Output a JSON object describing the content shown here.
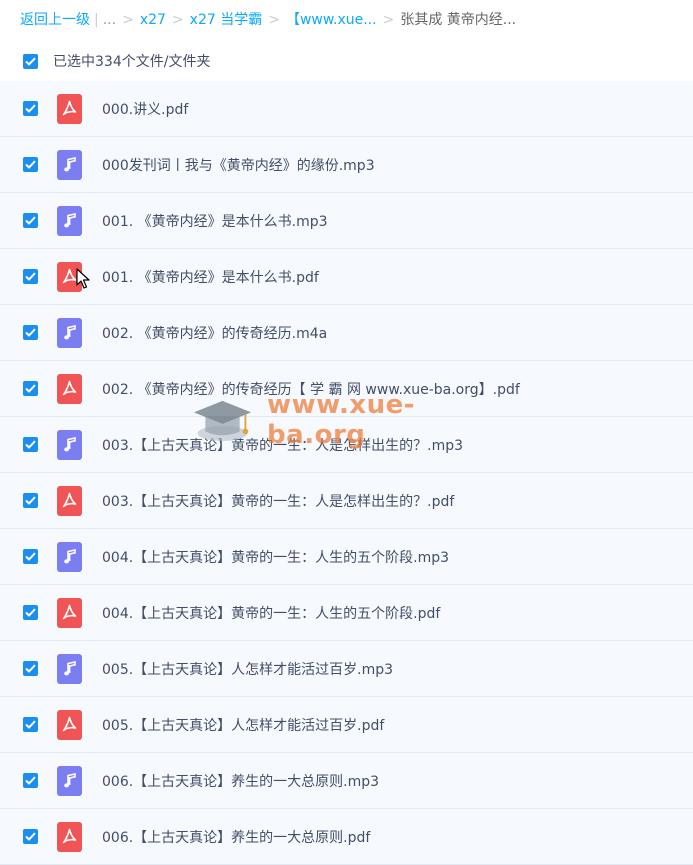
{
  "breadcrumb": {
    "back": "返回上一级",
    "pipe": "|",
    "ellipsis": "...",
    "items": [
      "x27",
      "x27 当学霸",
      "【www.xue...",
      "张其成 黄帝内经..."
    ]
  },
  "selection": {
    "label": "已选中334个文件/文件夹",
    "checked": true
  },
  "files": [
    {
      "name": "000.讲义.pdf",
      "type": "pdf",
      "checked": true
    },
    {
      "name": "000发刊词丨我与《黄帝内经》的缘份.mp3",
      "type": "audio",
      "checked": true
    },
    {
      "name": "001. 《黄帝内经》是本什么书.mp3",
      "type": "audio",
      "checked": true
    },
    {
      "name": "001. 《黄帝内经》是本什么书.pdf",
      "type": "pdf",
      "checked": true
    },
    {
      "name": "002. 《黄帝内经》的传奇经历.m4a",
      "type": "audio",
      "checked": true
    },
    {
      "name": "002. 《黄帝内经》的传奇经历【 学 霸 网 www.xue-ba.org】.pdf",
      "type": "pdf",
      "checked": true
    },
    {
      "name": "003.【上古天真论】黄帝的一生：人是怎样出生的？.mp3",
      "type": "audio",
      "checked": true
    },
    {
      "name": "003.【上古天真论】黄帝的一生：人是怎样出生的？.pdf",
      "type": "pdf",
      "checked": true
    },
    {
      "name": "004.【上古天真论】黄帝的一生：人生的五个阶段.mp3",
      "type": "audio",
      "checked": true
    },
    {
      "name": "004.【上古天真论】黄帝的一生：人生的五个阶段.pdf",
      "type": "pdf",
      "checked": true
    },
    {
      "name": "005.【上古天真论】人怎样才能活过百岁.mp3",
      "type": "audio",
      "checked": true
    },
    {
      "name": "005.【上古天真论】人怎样才能活过百岁.pdf",
      "type": "pdf",
      "checked": true
    },
    {
      "name": "006.【上古天真论】养生的一大总原则.mp3",
      "type": "audio",
      "checked": true
    },
    {
      "name": "006.【上古天真论】养生的一大总原则.pdf",
      "type": "pdf",
      "checked": true
    }
  ],
  "watermark": {
    "text": "www.xue-ba.org",
    "icon": "graduation-cap-icon"
  },
  "icons": {
    "pdf": "pdf-file-icon",
    "audio": "music-file-icon",
    "check": "checkmark-icon"
  },
  "colors": {
    "link": "#09aaff",
    "checkbox": "#1a8ff0",
    "pdf": "#f05454",
    "audio": "#7a7ef0",
    "row_bg": "#f6fafe",
    "watermark": "#f07836"
  }
}
